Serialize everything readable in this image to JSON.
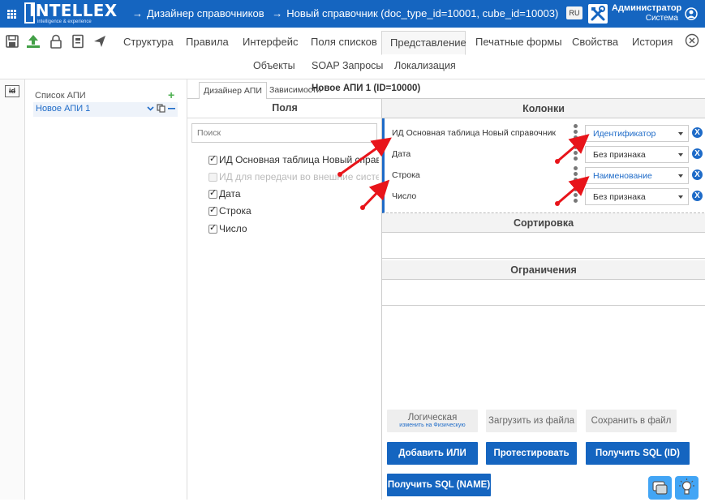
{
  "topbar": {
    "logo_text": "INTELLEX",
    "logo_subtitle": "intelligence & experience",
    "breadcrumb_arrow": "→",
    "breadcrumb_1": "Дизайнер справочников",
    "breadcrumb_2": "Новый справочник (doc_type_id=10001, cube_id=10003)",
    "language": "RU",
    "user_name": "Администратор",
    "user_role": "Система",
    "icons": [
      "apps-grid-icon",
      "tools-icon",
      "user-circle-icon"
    ]
  },
  "toolbar": {
    "icons": [
      "save-icon",
      "upload-icon",
      "lock-icon",
      "document-icon",
      "send-icon"
    ],
    "tabs": [
      "Структура",
      "Правила",
      "Интерфейс",
      "Поля списков",
      "Представление",
      "Печатные формы",
      "Свойства",
      "История"
    ],
    "active_tab": "Представление",
    "subtabs": [
      "Объекты",
      "SOAP Запросы",
      "Локализация"
    ],
    "close_icon": "close-circle-icon"
  },
  "rail": {
    "icon": "id-card-icon",
    "label": "id"
  },
  "api_list": {
    "title": "Список АПИ",
    "add_label": "+",
    "items": [
      {
        "label": "Новое АПИ 1",
        "icons": [
          "chevron-down-icon",
          "copy-icon",
          "minus-icon"
        ]
      }
    ]
  },
  "designer": {
    "tabs": [
      "Дизайнер АПИ",
      "Зависимости"
    ],
    "active_tab": "Дизайнер АПИ",
    "title": "Новое АПИ 1 (ID=10000)"
  },
  "fields": {
    "header": "Поля",
    "search_placeholder": "Поиск",
    "items": [
      {
        "label": "ИД Основная таблица Новый справочник",
        "checked": true,
        "disabled": false
      },
      {
        "label": "ИД для передачи во внешние системы",
        "checked": false,
        "disabled": true
      },
      {
        "label": "Дата",
        "checked": true,
        "disabled": false
      },
      {
        "label": "Строка",
        "checked": true,
        "disabled": false
      },
      {
        "label": "Число",
        "checked": true,
        "disabled": false
      }
    ]
  },
  "columns": {
    "header": "Колонки",
    "rows": [
      {
        "label": "ИД Основная таблица Новый справочник",
        "attribute": "Идентификатор",
        "highlight": true
      },
      {
        "label": "Дата",
        "attribute": "Без признака",
        "highlight": false
      },
      {
        "label": "Строка",
        "attribute": "Наименование",
        "highlight": true
      },
      {
        "label": "Число",
        "attribute": "Без признака",
        "highlight": false
      }
    ],
    "remove_label": "X"
  },
  "sorting": {
    "header": "Сортировка"
  },
  "constraints": {
    "header": "Ограничения"
  },
  "buttons": {
    "logical": "Логическая",
    "logical_sub": "изменить на Физическую",
    "load_file": "Загрузить из файла",
    "save_file": "Сохранить в файл",
    "add_or": "Добавить ИЛИ",
    "test": "Протестировать",
    "get_sql_id": "Получить SQL (ID)",
    "get_sql_name": "Получить SQL (NAME)"
  },
  "floating": [
    "chat-icon",
    "lightbulb-icon"
  ],
  "colors": {
    "primary": "#1565c0",
    "accent": "#1e6bc8",
    "annotation": "#e8141a",
    "add_green": "#4caf50"
  }
}
